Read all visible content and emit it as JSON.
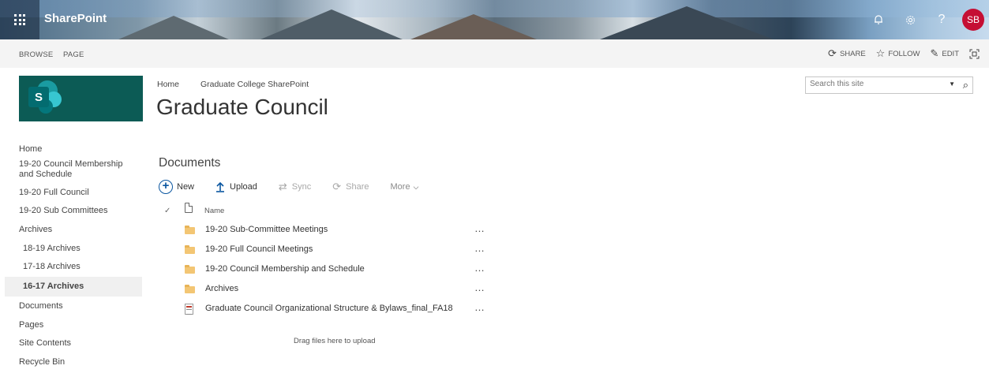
{
  "suite_bar": {
    "brand": "SharePoint",
    "avatar_initials": "SB",
    "icons": [
      "bell-icon",
      "gear-icon",
      "help-icon"
    ]
  },
  "ribbon": {
    "tabs": [
      "BROWSE",
      "PAGE"
    ],
    "actions": {
      "share": "SHARE",
      "follow": "FOLLOW",
      "edit": "EDIT"
    }
  },
  "header": {
    "breadcrumb": [
      "Home",
      "Graduate College SharePoint"
    ],
    "title": "Graduate Council",
    "search_placeholder": "Search this site"
  },
  "left_nav": [
    {
      "label": "Home"
    },
    {
      "label": "19-20 Council Membership and Schedule"
    },
    {
      "label": "19-20 Full Council"
    },
    {
      "label": "19-20 Sub Committees"
    },
    {
      "label": "Archives"
    },
    {
      "label": "18-19 Archives"
    },
    {
      "label": "17-18 Archives"
    },
    {
      "label": "16-17 Archives"
    },
    {
      "label": "Documents"
    },
    {
      "label": "Pages"
    },
    {
      "label": "Site Contents"
    },
    {
      "label": "Recycle Bin"
    }
  ],
  "documents": {
    "title": "Documents",
    "toolbar": {
      "new": "New",
      "upload": "Upload",
      "sync": "Sync",
      "share": "Share",
      "more": "More"
    },
    "column_name": "Name",
    "rows": [
      {
        "name": "19-20 Sub-Committee Meetings",
        "type": "folder"
      },
      {
        "name": "19-20 Full Council Meetings",
        "type": "folder"
      },
      {
        "name": "19-20 Council Membership and Schedule",
        "type": "folder"
      },
      {
        "name": "Archives",
        "type": "folder"
      },
      {
        "name": "Graduate Council Organizational Structure & Bylaws_final_FA18",
        "type": "pdf"
      }
    ],
    "drop_hint": "Drag files here to upload"
  }
}
